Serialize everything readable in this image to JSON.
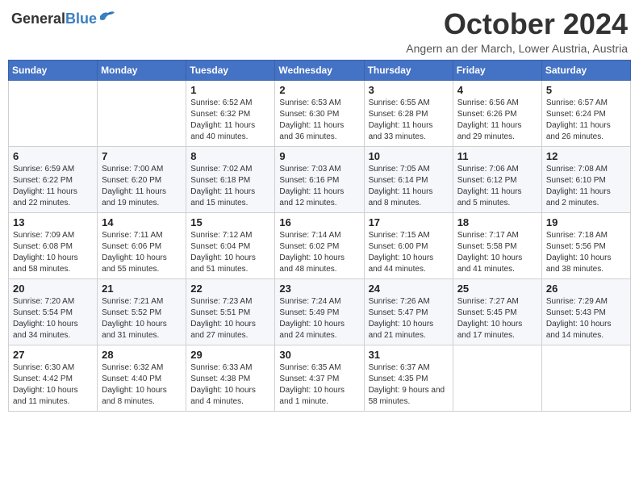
{
  "header": {
    "logo_general": "General",
    "logo_blue": "Blue",
    "month_title": "October 2024",
    "location": "Angern an der March, Lower Austria, Austria"
  },
  "weekdays": [
    "Sunday",
    "Monday",
    "Tuesday",
    "Wednesday",
    "Thursday",
    "Friday",
    "Saturday"
  ],
  "weeks": [
    [
      {
        "day": "",
        "info": ""
      },
      {
        "day": "",
        "info": ""
      },
      {
        "day": "1",
        "info": "Sunrise: 6:52 AM\nSunset: 6:32 PM\nDaylight: 11 hours and 40 minutes."
      },
      {
        "day": "2",
        "info": "Sunrise: 6:53 AM\nSunset: 6:30 PM\nDaylight: 11 hours and 36 minutes."
      },
      {
        "day": "3",
        "info": "Sunrise: 6:55 AM\nSunset: 6:28 PM\nDaylight: 11 hours and 33 minutes."
      },
      {
        "day": "4",
        "info": "Sunrise: 6:56 AM\nSunset: 6:26 PM\nDaylight: 11 hours and 29 minutes."
      },
      {
        "day": "5",
        "info": "Sunrise: 6:57 AM\nSunset: 6:24 PM\nDaylight: 11 hours and 26 minutes."
      }
    ],
    [
      {
        "day": "6",
        "info": "Sunrise: 6:59 AM\nSunset: 6:22 PM\nDaylight: 11 hours and 22 minutes."
      },
      {
        "day": "7",
        "info": "Sunrise: 7:00 AM\nSunset: 6:20 PM\nDaylight: 11 hours and 19 minutes."
      },
      {
        "day": "8",
        "info": "Sunrise: 7:02 AM\nSunset: 6:18 PM\nDaylight: 11 hours and 15 minutes."
      },
      {
        "day": "9",
        "info": "Sunrise: 7:03 AM\nSunset: 6:16 PM\nDaylight: 11 hours and 12 minutes."
      },
      {
        "day": "10",
        "info": "Sunrise: 7:05 AM\nSunset: 6:14 PM\nDaylight: 11 hours and 8 minutes."
      },
      {
        "day": "11",
        "info": "Sunrise: 7:06 AM\nSunset: 6:12 PM\nDaylight: 11 hours and 5 minutes."
      },
      {
        "day": "12",
        "info": "Sunrise: 7:08 AM\nSunset: 6:10 PM\nDaylight: 11 hours and 2 minutes."
      }
    ],
    [
      {
        "day": "13",
        "info": "Sunrise: 7:09 AM\nSunset: 6:08 PM\nDaylight: 10 hours and 58 minutes."
      },
      {
        "day": "14",
        "info": "Sunrise: 7:11 AM\nSunset: 6:06 PM\nDaylight: 10 hours and 55 minutes."
      },
      {
        "day": "15",
        "info": "Sunrise: 7:12 AM\nSunset: 6:04 PM\nDaylight: 10 hours and 51 minutes."
      },
      {
        "day": "16",
        "info": "Sunrise: 7:14 AM\nSunset: 6:02 PM\nDaylight: 10 hours and 48 minutes."
      },
      {
        "day": "17",
        "info": "Sunrise: 7:15 AM\nSunset: 6:00 PM\nDaylight: 10 hours and 44 minutes."
      },
      {
        "day": "18",
        "info": "Sunrise: 7:17 AM\nSunset: 5:58 PM\nDaylight: 10 hours and 41 minutes."
      },
      {
        "day": "19",
        "info": "Sunrise: 7:18 AM\nSunset: 5:56 PM\nDaylight: 10 hours and 38 minutes."
      }
    ],
    [
      {
        "day": "20",
        "info": "Sunrise: 7:20 AM\nSunset: 5:54 PM\nDaylight: 10 hours and 34 minutes."
      },
      {
        "day": "21",
        "info": "Sunrise: 7:21 AM\nSunset: 5:52 PM\nDaylight: 10 hours and 31 minutes."
      },
      {
        "day": "22",
        "info": "Sunrise: 7:23 AM\nSunset: 5:51 PM\nDaylight: 10 hours and 27 minutes."
      },
      {
        "day": "23",
        "info": "Sunrise: 7:24 AM\nSunset: 5:49 PM\nDaylight: 10 hours and 24 minutes."
      },
      {
        "day": "24",
        "info": "Sunrise: 7:26 AM\nSunset: 5:47 PM\nDaylight: 10 hours and 21 minutes."
      },
      {
        "day": "25",
        "info": "Sunrise: 7:27 AM\nSunset: 5:45 PM\nDaylight: 10 hours and 17 minutes."
      },
      {
        "day": "26",
        "info": "Sunrise: 7:29 AM\nSunset: 5:43 PM\nDaylight: 10 hours and 14 minutes."
      }
    ],
    [
      {
        "day": "27",
        "info": "Sunrise: 6:30 AM\nSunset: 4:42 PM\nDaylight: 10 hours and 11 minutes."
      },
      {
        "day": "28",
        "info": "Sunrise: 6:32 AM\nSunset: 4:40 PM\nDaylight: 10 hours and 8 minutes."
      },
      {
        "day": "29",
        "info": "Sunrise: 6:33 AM\nSunset: 4:38 PM\nDaylight: 10 hours and 4 minutes."
      },
      {
        "day": "30",
        "info": "Sunrise: 6:35 AM\nSunset: 4:37 PM\nDaylight: 10 hours and 1 minute."
      },
      {
        "day": "31",
        "info": "Sunrise: 6:37 AM\nSunset: 4:35 PM\nDaylight: 9 hours and 58 minutes."
      },
      {
        "day": "",
        "info": ""
      },
      {
        "day": "",
        "info": ""
      }
    ]
  ]
}
